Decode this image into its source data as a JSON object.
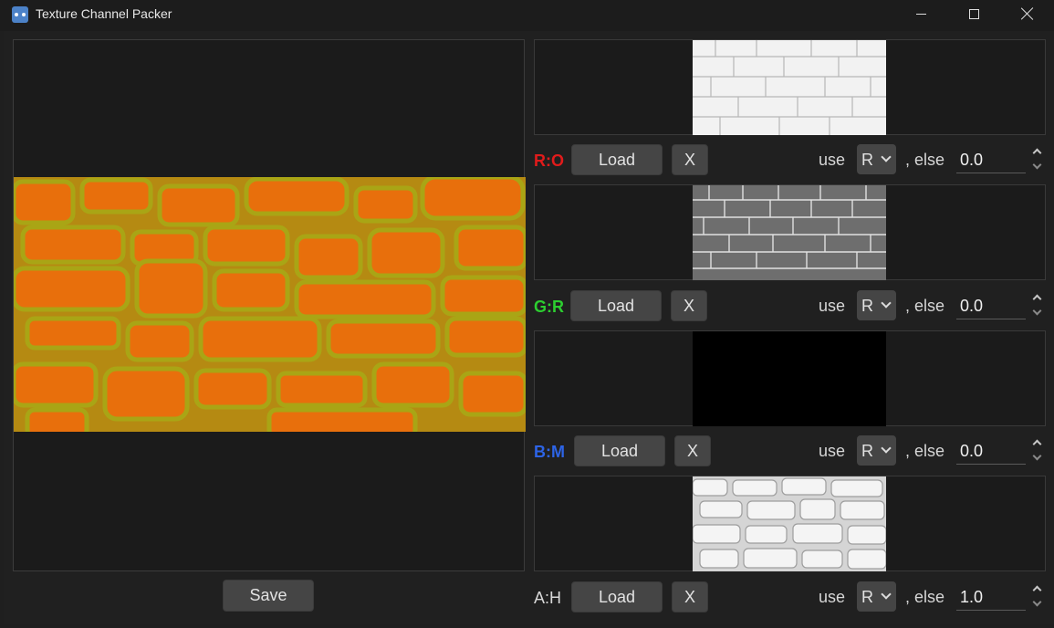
{
  "window": {
    "title": "Texture Channel Packer",
    "minimize_icon": "minimize-icon",
    "maximize_icon": "maximize-icon",
    "close_icon": "close-icon"
  },
  "preview": {
    "save_label": "Save"
  },
  "channels": [
    {
      "label": "R:O",
      "color": "#e11b1b",
      "load_label": "Load",
      "clear_label": "X",
      "use_label": "use",
      "select_value": "R",
      "else_label": ", else",
      "fallback_value": "0.0"
    },
    {
      "label": "G:R",
      "color": "#2cce30",
      "load_label": "Load",
      "clear_label": "X",
      "use_label": "use",
      "select_value": "R",
      "else_label": ", else",
      "fallback_value": "0.0"
    },
    {
      "label": "B:M",
      "color": "#2d64e6",
      "load_label": "Load",
      "clear_label": "X",
      "use_label": "use",
      "select_value": "R",
      "else_label": ", else",
      "fallback_value": "0.0"
    },
    {
      "label": "A:H",
      "color": "#d8d8d8",
      "load_label": "Load",
      "clear_label": "X",
      "use_label": "use",
      "select_value": "R",
      "else_label": ", else",
      "fallback_value": "1.0"
    }
  ]
}
